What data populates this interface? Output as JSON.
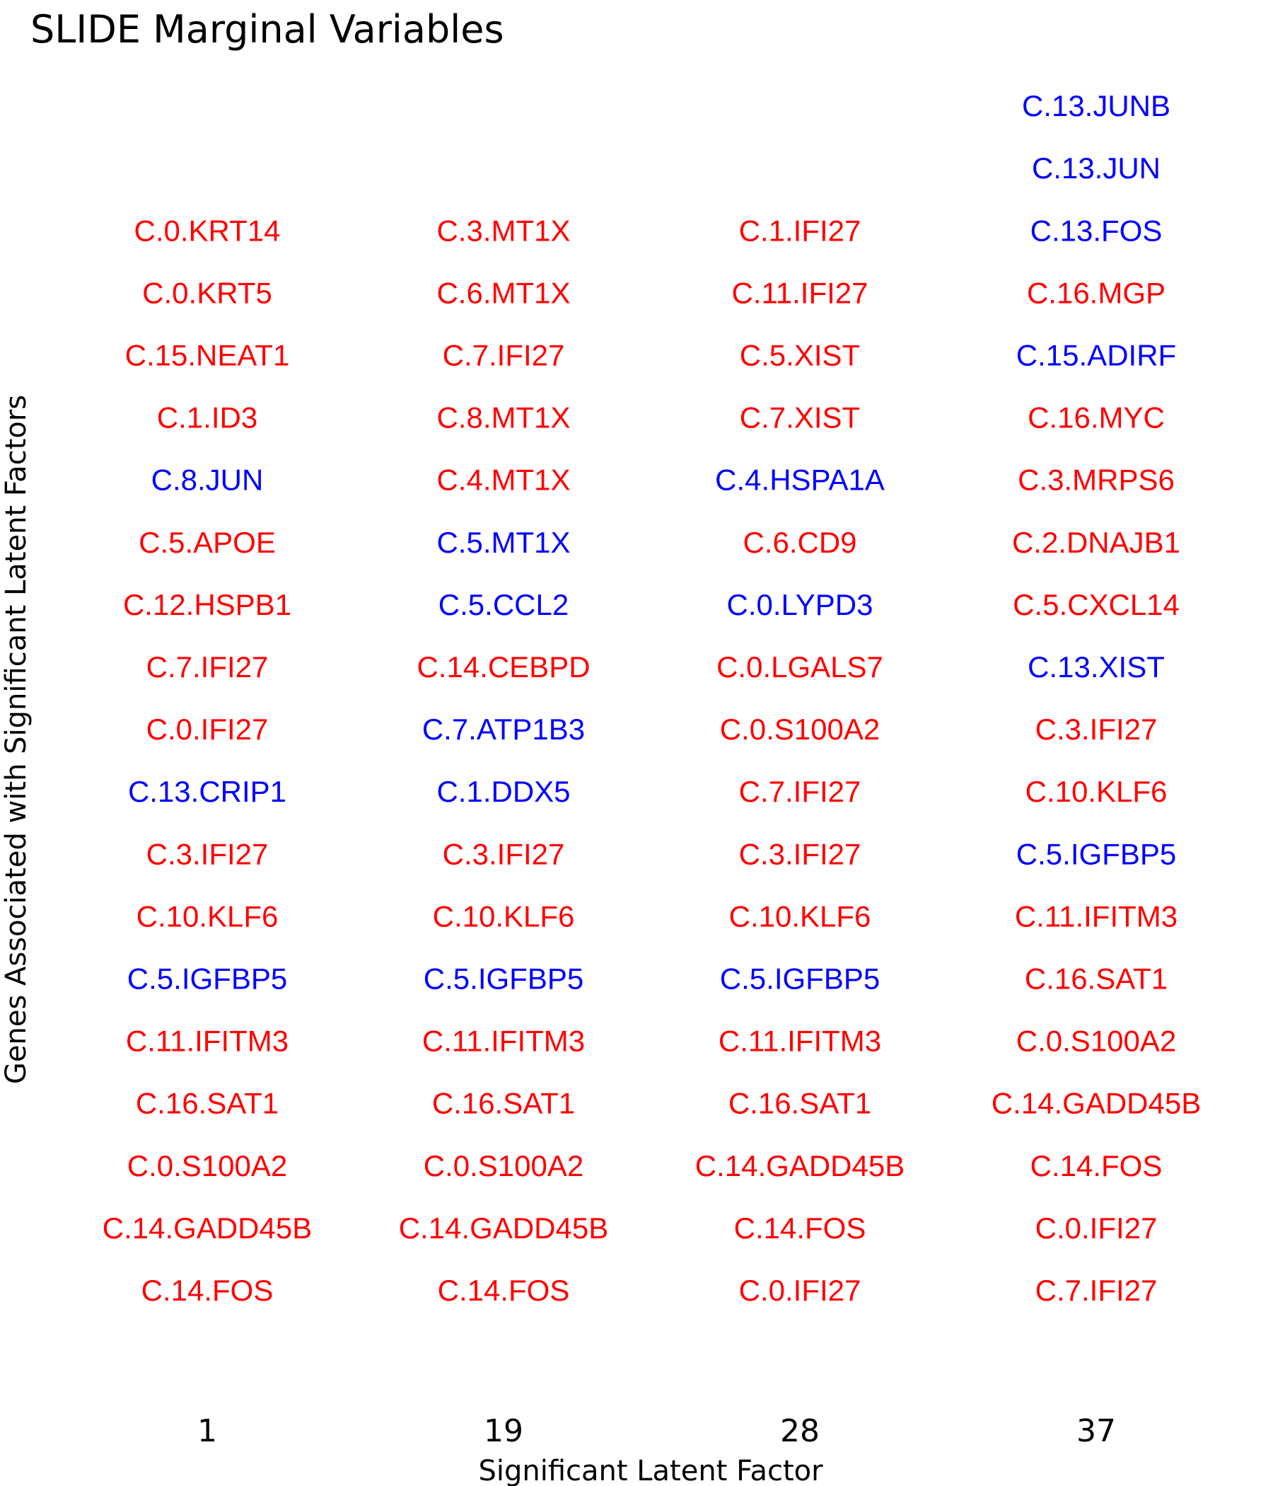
{
  "chart_data": {
    "type": "text-grid",
    "title": "SLIDE Marginal Variables",
    "xlabel": "Significant Latent Factor",
    "ylabel": "Genes Associated with Significant Latent Factors",
    "colors": {
      "positive": "#ff0000",
      "negative": "#0000ff"
    },
    "categories": [
      "1",
      "19",
      "28",
      "37"
    ],
    "columns": [
      {
        "factor": "1",
        "genes": [
          {
            "label": "C.0.KRT14",
            "color": "#ff0000"
          },
          {
            "label": "C.0.KRT5",
            "color": "#ff0000"
          },
          {
            "label": "C.15.NEAT1",
            "color": "#ff0000"
          },
          {
            "label": "C.1.ID3",
            "color": "#ff0000"
          },
          {
            "label": "C.8.JUN",
            "color": "#0000ff"
          },
          {
            "label": "C.5.APOE",
            "color": "#ff0000"
          },
          {
            "label": "C.12.HSPB1",
            "color": "#ff0000"
          },
          {
            "label": "C.7.IFI27",
            "color": "#ff0000"
          },
          {
            "label": "C.0.IFI27",
            "color": "#ff0000"
          },
          {
            "label": "C.13.CRIP1",
            "color": "#0000ff"
          },
          {
            "label": "C.3.IFI27",
            "color": "#ff0000"
          },
          {
            "label": "C.10.KLF6",
            "color": "#ff0000"
          },
          {
            "label": "C.5.IGFBP5",
            "color": "#0000ff"
          },
          {
            "label": "C.11.IFITM3",
            "color": "#ff0000"
          },
          {
            "label": "C.16.SAT1",
            "color": "#ff0000"
          },
          {
            "label": "C.0.S100A2",
            "color": "#ff0000"
          },
          {
            "label": "C.14.GADD45B",
            "color": "#ff0000"
          },
          {
            "label": "C.14.FOS",
            "color": "#ff0000"
          }
        ]
      },
      {
        "factor": "19",
        "genes": [
          {
            "label": "C.3.MT1X",
            "color": "#ff0000"
          },
          {
            "label": "C.6.MT1X",
            "color": "#ff0000"
          },
          {
            "label": "C.7.IFI27",
            "color": "#ff0000"
          },
          {
            "label": "C.8.MT1X",
            "color": "#ff0000"
          },
          {
            "label": "C.4.MT1X",
            "color": "#ff0000"
          },
          {
            "label": "C.5.MT1X",
            "color": "#0000ff"
          },
          {
            "label": "C.5.CCL2",
            "color": "#0000ff"
          },
          {
            "label": "C.14.CEBPD",
            "color": "#ff0000"
          },
          {
            "label": "C.7.ATP1B3",
            "color": "#0000ff"
          },
          {
            "label": "C.1.DDX5",
            "color": "#0000ff"
          },
          {
            "label": "C.3.IFI27",
            "color": "#ff0000"
          },
          {
            "label": "C.10.KLF6",
            "color": "#ff0000"
          },
          {
            "label": "C.5.IGFBP5",
            "color": "#0000ff"
          },
          {
            "label": "C.11.IFITM3",
            "color": "#ff0000"
          },
          {
            "label": "C.16.SAT1",
            "color": "#ff0000"
          },
          {
            "label": "C.0.S100A2",
            "color": "#ff0000"
          },
          {
            "label": "C.14.GADD45B",
            "color": "#ff0000"
          },
          {
            "label": "C.14.FOS",
            "color": "#ff0000"
          }
        ]
      },
      {
        "factor": "28",
        "genes": [
          {
            "label": "C.1.IFI27",
            "color": "#ff0000"
          },
          {
            "label": "C.11.IFI27",
            "color": "#ff0000"
          },
          {
            "label": "C.5.XIST",
            "color": "#ff0000"
          },
          {
            "label": "C.7.XIST",
            "color": "#ff0000"
          },
          {
            "label": "C.4.HSPA1A",
            "color": "#0000ff"
          },
          {
            "label": "C.6.CD9",
            "color": "#ff0000"
          },
          {
            "label": "C.0.LYPD3",
            "color": "#0000ff"
          },
          {
            "label": "C.0.LGALS7",
            "color": "#ff0000"
          },
          {
            "label": "C.0.S100A2",
            "color": "#ff0000"
          },
          {
            "label": "C.7.IFI27",
            "color": "#ff0000"
          },
          {
            "label": "C.3.IFI27",
            "color": "#ff0000"
          },
          {
            "label": "C.10.KLF6",
            "color": "#ff0000"
          },
          {
            "label": "C.5.IGFBP5",
            "color": "#0000ff"
          },
          {
            "label": "C.11.IFITM3",
            "color": "#ff0000"
          },
          {
            "label": "C.16.SAT1",
            "color": "#ff0000"
          },
          {
            "label": "C.14.GADD45B",
            "color": "#ff0000"
          },
          {
            "label": "C.14.FOS",
            "color": "#ff0000"
          },
          {
            "label": "C.0.IFI27",
            "color": "#ff0000"
          }
        ]
      },
      {
        "factor": "37",
        "genes": [
          {
            "label": "C.13.JUNB",
            "color": "#0000ff"
          },
          {
            "label": "C.13.JUN",
            "color": "#0000ff"
          },
          {
            "label": "C.13.FOS",
            "color": "#0000ff"
          },
          {
            "label": "C.16.MGP",
            "color": "#ff0000"
          },
          {
            "label": "C.15.ADIRF",
            "color": "#0000ff"
          },
          {
            "label": "C.16.MYC",
            "color": "#ff0000"
          },
          {
            "label": "C.3.MRPS6",
            "color": "#ff0000"
          },
          {
            "label": "C.2.DNAJB1",
            "color": "#ff0000"
          },
          {
            "label": "C.5.CXCL14",
            "color": "#ff0000"
          },
          {
            "label": "C.13.XIST",
            "color": "#0000ff"
          },
          {
            "label": "C.3.IFI27",
            "color": "#ff0000"
          },
          {
            "label": "C.10.KLF6",
            "color": "#ff0000"
          },
          {
            "label": "C.5.IGFBP5",
            "color": "#0000ff"
          },
          {
            "label": "C.11.IFITM3",
            "color": "#ff0000"
          },
          {
            "label": "C.16.SAT1",
            "color": "#ff0000"
          },
          {
            "label": "C.0.S100A2",
            "color": "#ff0000"
          },
          {
            "label": "C.14.GADD45B",
            "color": "#ff0000"
          },
          {
            "label": "C.14.FOS",
            "color": "#ff0000"
          },
          {
            "label": "C.0.IFI27",
            "color": "#ff0000"
          },
          {
            "label": "C.7.IFI27",
            "color": "#ff0000"
          }
        ]
      }
    ]
  }
}
